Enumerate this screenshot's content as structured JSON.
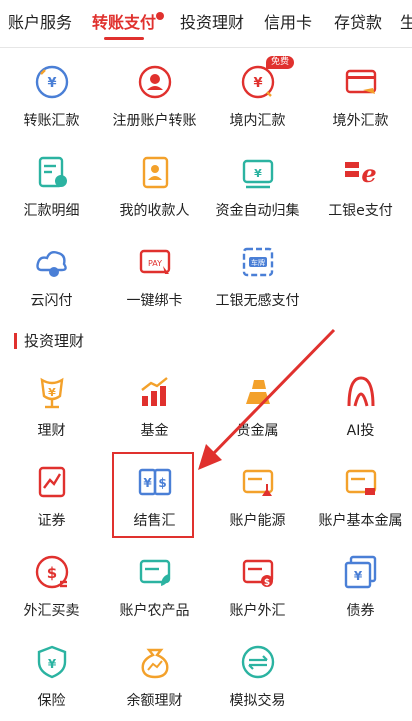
{
  "tabs": [
    {
      "label": "账户服务",
      "active": false
    },
    {
      "label": "转账支付",
      "active": true,
      "dot": true
    },
    {
      "label": "投资理财",
      "active": false
    },
    {
      "label": "信用卡",
      "active": false
    },
    {
      "label": "存贷款",
      "active": false
    },
    {
      "label": "生",
      "active": false
    }
  ],
  "transfer": [
    {
      "label": "转账汇款",
      "icon": "transfer-icon"
    },
    {
      "label": "注册账户转账",
      "icon": "registered-transfer-icon"
    },
    {
      "label": "境内汇款",
      "icon": "domestic-remit-icon",
      "badge": "免费"
    },
    {
      "label": "境外汇款",
      "icon": "overseas-remit-icon"
    },
    {
      "label": "汇款明细",
      "icon": "remit-detail-icon"
    },
    {
      "label": "我的收款人",
      "icon": "payee-icon"
    },
    {
      "label": "资金自动归集",
      "icon": "fund-collect-icon"
    },
    {
      "label": "工银e支付",
      "icon": "e-pay-icon"
    },
    {
      "label": "云闪付",
      "icon": "cloud-pay-icon"
    },
    {
      "label": "一键绑卡",
      "icon": "bind-card-icon"
    },
    {
      "label": "工银无感支付",
      "icon": "car-pay-icon"
    }
  ],
  "invest_section": {
    "title": "投资理财"
  },
  "invest": [
    {
      "label": "理财",
      "icon": "wealth-icon"
    },
    {
      "label": "基金",
      "icon": "fund-chart-icon"
    },
    {
      "label": "贵金属",
      "icon": "gold-bar-icon"
    },
    {
      "label": "AI投",
      "icon": "ai-invest-icon"
    },
    {
      "label": "证券",
      "icon": "securities-icon"
    },
    {
      "label": "结售汇",
      "icon": "fx-settle-icon"
    },
    {
      "label": "账户能源",
      "icon": "account-energy-icon"
    },
    {
      "label": "账户基本金属",
      "icon": "base-metal-icon"
    },
    {
      "label": "外汇买卖",
      "icon": "fx-trade-icon"
    },
    {
      "label": "账户农产品",
      "icon": "agri-icon"
    },
    {
      "label": "账户外汇",
      "icon": "account-fx-icon"
    },
    {
      "label": "债券",
      "icon": "bond-icon"
    },
    {
      "label": "保险",
      "icon": "insurance-icon"
    },
    {
      "label": "余额理财",
      "icon": "balance-wealth-icon"
    },
    {
      "label": "模拟交易",
      "icon": "sim-trade-icon"
    }
  ],
  "icon_glyphs": {
    "currency": "¥",
    "dollar": "$",
    "pay": "PAY",
    "car": "车牌"
  },
  "colors": {
    "accent": "#e0312e",
    "blue": "#4a7fd6",
    "orange": "#f3a12b",
    "teal": "#2bb3a1"
  }
}
